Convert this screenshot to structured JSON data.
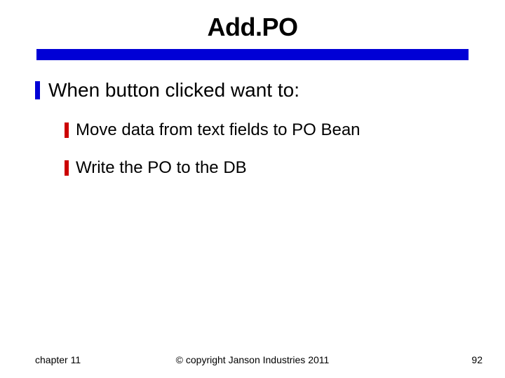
{
  "title": "Add.PO",
  "bullets": {
    "level1": {
      "item0": "When button clicked want to:"
    },
    "level2": {
      "item0": "Move data from text fields to PO Bean",
      "item1": "Write the PO to the DB"
    }
  },
  "footer": {
    "left": "chapter 11",
    "center": "© copyright Janson Industries 2011",
    "right": "92"
  },
  "colors": {
    "divider": "#0000d6",
    "bullet_l1": "#0000d6",
    "bullet_l2": "#cc0000"
  }
}
